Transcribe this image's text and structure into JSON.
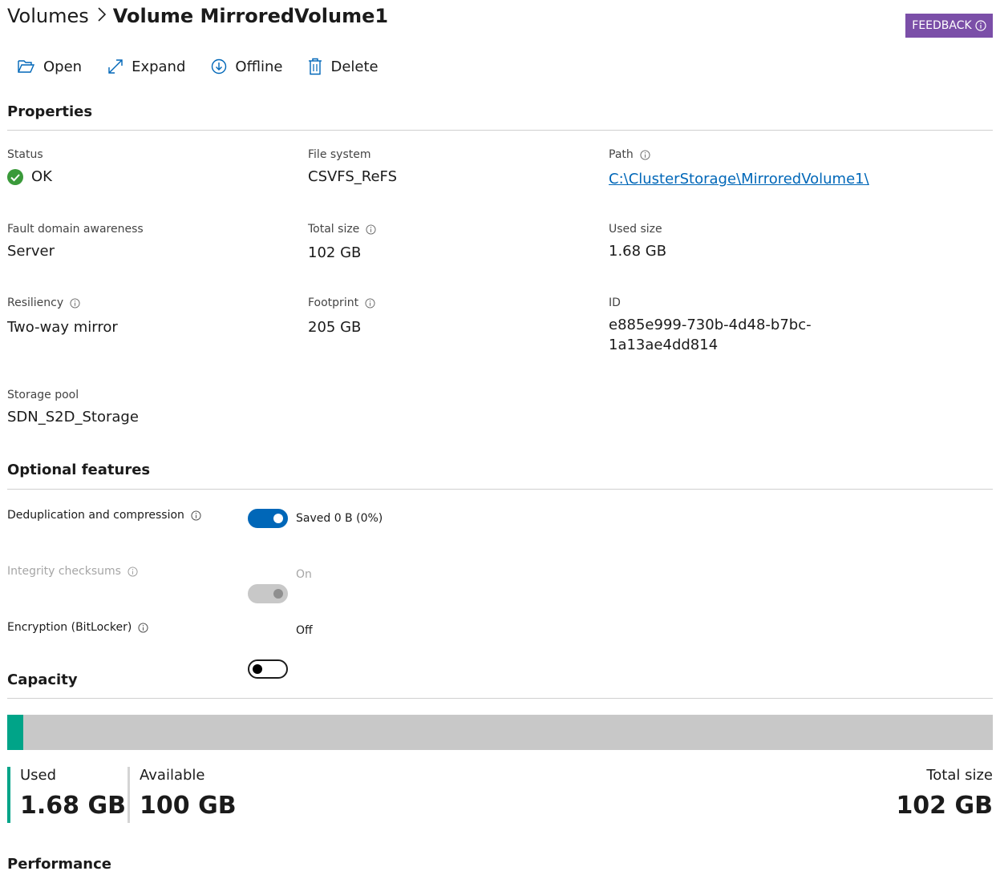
{
  "breadcrumb": {
    "parent": "Volumes",
    "current": "Volume MirroredVolume1"
  },
  "feedback_label": "FEEDBACK",
  "toolbar": {
    "open": "Open",
    "expand": "Expand",
    "offline": "Offline",
    "delete": "Delete"
  },
  "properties": {
    "title": "Properties",
    "status": {
      "label": "Status",
      "value": "OK"
    },
    "file_system": {
      "label": "File system",
      "value": "CSVFS_ReFS"
    },
    "path": {
      "label": "Path",
      "value": "C:\\ClusterStorage\\MirroredVolume1\\"
    },
    "fault_domain": {
      "label": "Fault domain awareness",
      "value": "Server"
    },
    "total_size": {
      "label": "Total size",
      "value": "102 GB"
    },
    "used_size": {
      "label": "Used size",
      "value": "1.68 GB"
    },
    "resiliency": {
      "label": "Resiliency",
      "value": "Two-way mirror"
    },
    "footprint": {
      "label": "Footprint",
      "value": "205 GB"
    },
    "id": {
      "label": "ID",
      "line1": "e885e999-730b-4d48-b7bc-",
      "line2": "1a13ae4dd814"
    },
    "storage_pool": {
      "label": "Storage pool",
      "value": "SDN_S2D_Storage"
    }
  },
  "optional_features": {
    "title": "Optional features",
    "dedup": {
      "label": "Deduplication and compression",
      "state": "Saved 0 B (0%)",
      "on": true
    },
    "integrity": {
      "label": "Integrity checksums",
      "state": "On",
      "disabled": true
    },
    "encryption": {
      "label": "Encryption (BitLocker)",
      "state": "Off",
      "on": false
    }
  },
  "capacity": {
    "title": "Capacity",
    "used_fraction": 0.0165,
    "used_label": "Used",
    "used_value": "1.68 GB",
    "available_label": "Available",
    "available_value": "100 GB",
    "total_label": "Total size",
    "total_value": "102 GB"
  },
  "performance_title": "Performance",
  "colors": {
    "accent": "#0067b8",
    "feedback": "#7b4fa8",
    "used": "#00a488",
    "ok": "#3a9a3a"
  }
}
